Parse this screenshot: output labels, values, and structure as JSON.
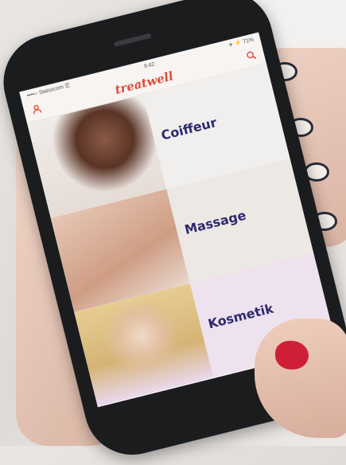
{
  "statusbar": {
    "left": "••••○ Swisscom  ☰",
    "time": "9:42",
    "right": "✈ ⚡ 71%"
  },
  "appbar": {
    "user_icon": "user-icon",
    "logo": "treatwell",
    "search_icon": "search-icon"
  },
  "categories": [
    {
      "label": "Coiffeur",
      "icon": "photo-woman-hair"
    },
    {
      "label": "Massage",
      "icon": "photo-massage-hands"
    },
    {
      "label": "Kosmetik",
      "icon": "photo-blonde-woman"
    }
  ],
  "colors": {
    "brand": "#e04a3c",
    "label": "#2d2a6e",
    "nail_red": "#cf1f36"
  }
}
